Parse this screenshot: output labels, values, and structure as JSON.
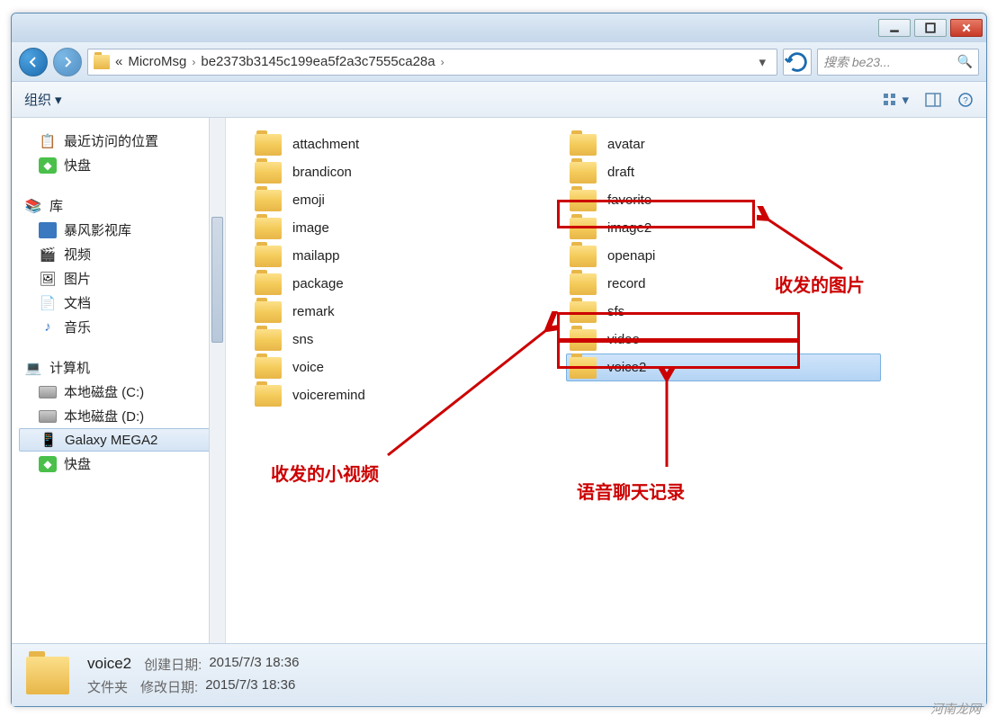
{
  "titlebar": {
    "min": "_",
    "max": "☐",
    "close": "✕"
  },
  "address": {
    "prefix": "«",
    "part1": "MicroMsg",
    "sep": "›",
    "part2": "be2373b3145c199ea5f2a3c7555ca28a",
    "drop": "▾",
    "search_placeholder": "搜索 be23..."
  },
  "toolbar": {
    "organize": "组织",
    "drop": "▾"
  },
  "sidebar": {
    "recent": "最近访问的位置",
    "kuaipan": "快盘",
    "libraries": "库",
    "baofeng": "暴风影视库",
    "videos": "视频",
    "pictures": "图片",
    "documents": "文档",
    "music": "音乐",
    "computer": "计算机",
    "disk_c": "本地磁盘 (C:)",
    "disk_d": "本地磁盘 (D:)",
    "galaxy": "Galaxy MEGA2",
    "kuaipan2": "快盘"
  },
  "col1": [
    "attachment",
    "brandicon",
    "emoji",
    "image",
    "mailapp",
    "package",
    "remark",
    "sns",
    "voice",
    "voiceremind"
  ],
  "col2": [
    "avatar",
    "draft",
    "favorite",
    "image2",
    "openapi",
    "record",
    "sfs",
    "video",
    "voice2"
  ],
  "selected": "voice2",
  "annotations": {
    "image2_label": "收发的图片",
    "video_label": "收发的小视频",
    "voice2_label": "语音聊天记录"
  },
  "status": {
    "name": "voice2",
    "type": "文件夹",
    "created_label": "创建日期:",
    "created": "2015/7/3 18:36",
    "modified_label": "修改日期:",
    "modified": "2015/7/3 18:36"
  },
  "watermark": "河南龙网"
}
